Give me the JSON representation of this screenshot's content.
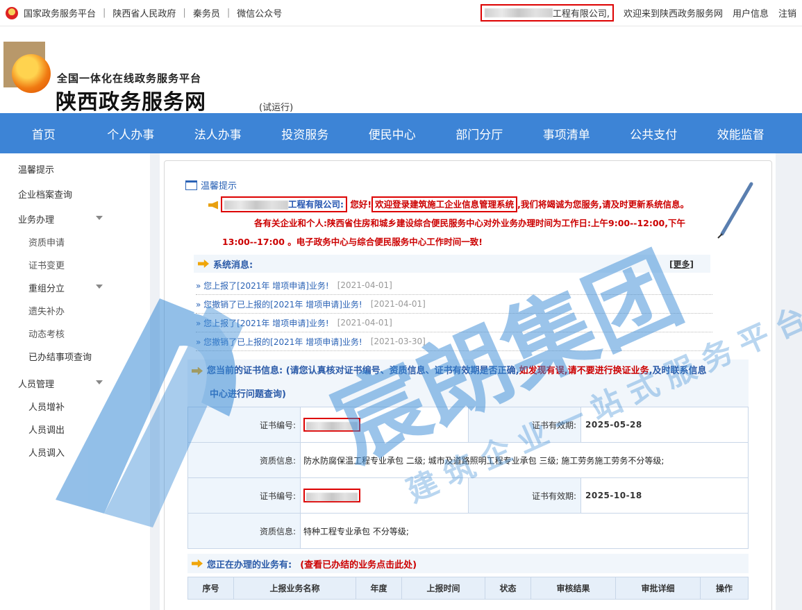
{
  "topbar": {
    "links": [
      "国家政务服务平台",
      "陕西省人民政府",
      "秦务员",
      "微信公众号"
    ],
    "company_suffix": "工程有限公司,",
    "welcome": "欢迎来到陕西政务服务网",
    "user_info": "用户信息",
    "logout": "注销"
  },
  "header": {
    "line1": "全国一体化在线政务服务平台",
    "line2": "陕西政务服务网",
    "trial": "(试运行)"
  },
  "nav": [
    "首页",
    "个人办事",
    "法人办事",
    "投资服务",
    "便民中心",
    "部门分厅",
    "事项清单",
    "公共支付",
    "效能监督"
  ],
  "sidebar": {
    "items": [
      {
        "label": "温馨提示",
        "level": "top"
      },
      {
        "label": "企业档案查询",
        "level": "top"
      },
      {
        "label": "业务办理",
        "level": "top",
        "caret": true
      },
      {
        "label": "资质申请",
        "level": "sub"
      },
      {
        "label": "证书变更",
        "level": "sub"
      },
      {
        "label": "重组分立",
        "level": "sub",
        "caret": true
      },
      {
        "label": "遗失补办",
        "level": "sub"
      },
      {
        "label": "动态考核",
        "level": "sub"
      },
      {
        "label": "已办结事项查询",
        "level": "sub"
      },
      {
        "label": "人员管理",
        "level": "top",
        "caret": true
      },
      {
        "label": "人员增补",
        "level": "sub"
      },
      {
        "label": "人员调出",
        "level": "sub"
      },
      {
        "label": "人员调入",
        "level": "sub"
      }
    ]
  },
  "tip": {
    "title": "温馨提示",
    "company_suffix": "工程有限公司:",
    "hello": "您好!",
    "welcome_box": "欢迎登录建筑施工企业信息管理系统",
    "rest1": ",我们将竭诚为您服务,请及时更新系统信息。",
    "line2": "各有关企业和个人:陕西省住房和城乡建设综合便民服务中心对外业务办理时间为工作日:上午9:00--12:00,下午",
    "line3": "13:00--17:00 。电子政务中心与综合便民服务中心工作时间一致!"
  },
  "system": {
    "title": "系统消息:",
    "more": "[更多]",
    "messages": [
      {
        "text": "» 您上报了[2021年 增项申请]业务!",
        "date": "[2021-04-01]"
      },
      {
        "text": "» 您撤销了已上报的[2021年 增项申请]业务!",
        "date": "[2021-04-01]"
      },
      {
        "text": "» 您上报了[2021年 增项申请]业务!",
        "date": "[2021-04-01]"
      },
      {
        "text": "» 您撤销了已上报的[2021年 增项申请]业务!",
        "date": "[2021-03-30]"
      }
    ]
  },
  "cert": {
    "title": "您当前的证书信息:",
    "note_blue1": "(请您认真核对证书编号、资质信息、证书有效期是否正确,",
    "note_red": "如发现有误,请不要进行换证业务",
    "note_blue2": ",及时联系信息",
    "note_blue3": "中心进行问题查询)",
    "rows": [
      {
        "no_label": "证书编号:",
        "exp_label": "证书有效期:",
        "exp": "2025-05-28",
        "qual_label": "资质信息:",
        "qual": "防水防腐保温工程专业承包 二级; 城市及道路照明工程专业承包 三级; 施工劳务施工劳务不分等级;"
      },
      {
        "no_label": "证书编号:",
        "exp_label": "证书有效期:",
        "exp": "2025-10-18",
        "qual_label": "资质信息:",
        "qual": "特种工程专业承包 不分等级;"
      }
    ]
  },
  "biz": {
    "title": "您正在办理的业务有:",
    "link": "(查看已办结的业务点击此处)",
    "columns": [
      "序号",
      "上报业务名称",
      "年度",
      "上报时间",
      "状态",
      "审核结果",
      "审批详细",
      "操作"
    ]
  },
  "watermark": {
    "big": "宸朗集团",
    "sub": "建筑企业一站式服务平台"
  },
  "colors": {
    "nav": "#3d84d6",
    "alert": "#cc0000",
    "link": "#2a62b5"
  }
}
